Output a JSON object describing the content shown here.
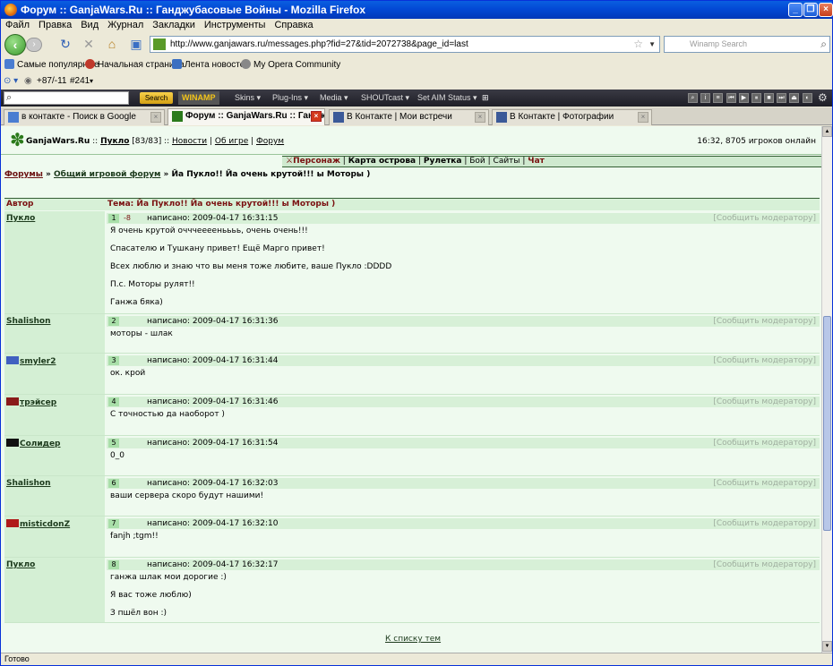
{
  "window": {
    "title": "Форум :: GanjaWars.Ru :: Ганджубасовые Войны - Mozilla Firefox"
  },
  "menu": [
    "Файл",
    "Правка",
    "Вид",
    "Журнал",
    "Закладки",
    "Инструменты",
    "Справка"
  ],
  "nav": {
    "url": "http://www.ganjawars.ru/messages.php?fid=27&tid=2072738&page_id=last",
    "search_placeholder": "Winamp Search"
  },
  "bookmarks": [
    {
      "label": "Самые популярные",
      "color": "#4a7dd1"
    },
    {
      "label": "Начальная страница",
      "color": "#c0392b"
    },
    {
      "label": "Лента новостей",
      "color": "#3b6fc1"
    },
    {
      "label": "My Opera Community",
      "color": "#888888"
    }
  ],
  "ext1": {
    "karma": "+87/-11",
    "num": "#241"
  },
  "winamp": {
    "search_btn": "Search",
    "logo": "WINAMP",
    "menus": [
      "Skins",
      "Plug-Ins",
      "Media",
      "SHOUTcast",
      "Set AIM Status"
    ]
  },
  "tabs": [
    {
      "label": "в контакте - Поиск в Google",
      "active": false,
      "color": "#4a7dd1"
    },
    {
      "label": "Форум :: GanjaWars.Ru :: Гандж...",
      "active": true,
      "color": "#2b7a1b"
    },
    {
      "label": "В Контакте | Мои встречи",
      "active": false,
      "color": "#3b5998"
    },
    {
      "label": "В Контакте | Фотографии",
      "active": false,
      "color": "#3b5998"
    }
  ],
  "site": {
    "name": "GanjaWars.Ru",
    "sep": "::",
    "user": "Пукло",
    "hp": "[83/83]",
    "links": [
      "Новости",
      "Об игре",
      "Форум"
    ],
    "online": "16:32, 8705 игроков онлайн",
    "nav2": [
      "Персонаж",
      "Карта острова",
      "Рулетка",
      "Бой",
      "Сайты",
      "Чат"
    ]
  },
  "breadcrumb": {
    "forums": "Форумы",
    "general": "Общий игровой форум",
    "topic": "Йа Пукло!! Йа очень крутой!!! ы Моторы )"
  },
  "table": {
    "col_author": "Автор",
    "col_topic": "Тема: Йа Пукло!! Йа очень крутой!!! ы Моторы )"
  },
  "report_label": "[Сообщить модератору]",
  "posts": [
    {
      "author": "Пукло",
      "num": "1",
      "karma": "-8",
      "date": "написано: 2009-04-17 16:31:15",
      "avatar": "",
      "lines": [
        "Я очень крутой очччееееньььь, очень очень!!!",
        "Спасателю и Тушкану привет! Ещё Марго привет!",
        "Всех люблю и знаю что вы меня тоже любите, ваше Пукло :DDDD",
        "П.с. Моторы рулят!!",
        "Ганжа бяка)"
      ]
    },
    {
      "author": "Shalishon",
      "num": "2",
      "karma": "",
      "date": "написано: 2009-04-17 16:31:36",
      "avatar": "",
      "lines": [
        "моторы - шлак"
      ]
    },
    {
      "author": "smyler2",
      "num": "3",
      "karma": "",
      "date": "написано: 2009-04-17 16:31:44",
      "avatar": "#4060c0",
      "lines": [
        "ок. крой"
      ]
    },
    {
      "author": "трэйсер",
      "num": "4",
      "karma": "",
      "date": "написано: 2009-04-17 16:31:46",
      "avatar": "#8a1a1a",
      "lines": [
        "С точностью да наоборот )"
      ]
    },
    {
      "author": "Солидер",
      "num": "5",
      "karma": "",
      "date": "написано: 2009-04-17 16:31:54",
      "avatar": "#111111",
      "lines": [
        "0_0"
      ]
    },
    {
      "author": "Shalishon",
      "num": "6",
      "karma": "",
      "date": "написано: 2009-04-17 16:32:03",
      "avatar": "",
      "lines": [
        "ваши сервера скоро будут нашими!"
      ]
    },
    {
      "author": "misticdonZ",
      "num": "7",
      "karma": "",
      "date": "написано: 2009-04-17 16:32:10",
      "avatar": "#b01a1a",
      "lines": [
        "fanjh ;tgm!!"
      ]
    },
    {
      "author": "Пукло",
      "num": "8",
      "karma": "",
      "date": "написано: 2009-04-17 16:32:17",
      "avatar": "",
      "lines": [
        "ганжа шлак мои дорогие :)",
        "Я вас тоже люблю)",
        "З пшёл вон :)"
      ]
    }
  ],
  "back_link": "К списку тем",
  "status": "Готово"
}
